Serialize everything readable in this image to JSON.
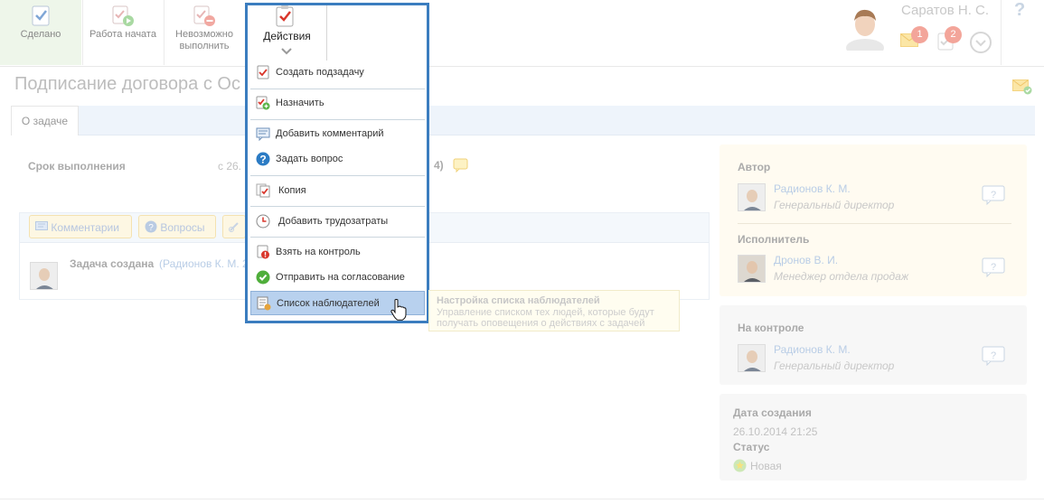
{
  "toolbar": {
    "done_label": "Сделано",
    "started_label": "Работа начата",
    "impossible_label_1": "Невозможно",
    "impossible_label_2": "выполнить",
    "actions_label": "Действия"
  },
  "user": {
    "name": "Саратов Н. С.",
    "messages_count": "1",
    "tasks_count": "2",
    "help": "?"
  },
  "task": {
    "title": "Подписание договора с Ос",
    "tab_about": "О задаче",
    "deadline_label": "Срок выполнения",
    "deadline_value": "с 26.",
    "deadline_tail": "4)"
  },
  "comments": {
    "comments_label": "Комментарии",
    "questions_label": "Вопросы",
    "entry_title": "Задача создана",
    "entry_author": "(Радионов К. М. 2"
  },
  "menu": {
    "items": [
      {
        "label": "Создать подзадачу"
      },
      {
        "label": "Назначить"
      },
      {
        "label": "Добавить комментарий"
      },
      {
        "label": "Задать вопрос"
      },
      {
        "label": "Копия"
      },
      {
        "label": "Добавить трудозатраты"
      },
      {
        "label": "Взять на контроль"
      },
      {
        "label": "Отправить на согласование"
      },
      {
        "label": "Список наблюдателей"
      }
    ]
  },
  "tooltip": {
    "title": "Настройка списка наблюдателей",
    "line1": "Управление списком тех людей, которые будут",
    "line2": "получать оповещения о действиях с задачей"
  },
  "sidebar": {
    "author_label": "Автор",
    "author_name": "Радионов К. М.",
    "author_pos": "Генеральный директор",
    "executor_label": "Исполнитель",
    "executor_name": "Дронов В. И.",
    "executor_pos": "Менеджер отдела продаж",
    "control_label": "На контроле",
    "control_name": "Радионов К. М.",
    "control_pos": "Генеральный директор",
    "created_label": "Дата создания",
    "created_value": "26.10.2014 21:25",
    "status_label": "Статус",
    "status_value": "Новая"
  },
  "colors": {
    "menu_border": "#3b7dbf",
    "menu_highlight": "#b8d1ee",
    "badge": "#f3a59a"
  }
}
